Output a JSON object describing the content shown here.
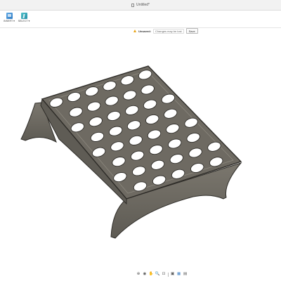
{
  "window": {
    "title": "Untitled*"
  },
  "toolbar": {
    "insert_label": "INSERT ▾",
    "select_label": "SELECT ▾"
  },
  "status": {
    "unsaved_label": "Unsaved:",
    "changes_label": "Changes may be lost",
    "save_label": "Save"
  },
  "viewport": {
    "model_color": "#6e6a62",
    "edge_color": "#2e2c28",
    "hole_rows": 8
  },
  "navbar": {
    "icons": [
      "orbit-icon",
      "look-at-icon",
      "pan-icon",
      "zoom-icon",
      "fit-icon",
      "display-settings-icon",
      "grid-icon",
      "viewports-icon"
    ],
    "glyphs": [
      "⊕",
      "◉",
      "✋",
      "🔍",
      "⊡",
      "▣",
      "▦",
      "▤"
    ]
  }
}
